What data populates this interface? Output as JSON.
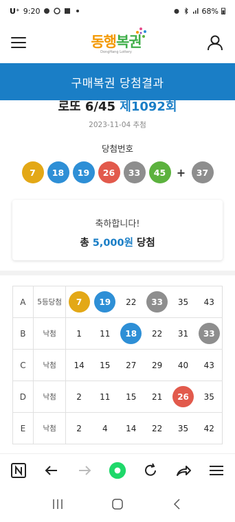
{
  "status": {
    "carrier": "U⁺",
    "time": "9:20",
    "battery": "68%"
  },
  "header": {
    "logo_main": "동행",
    "logo_main2": "복권",
    "logo_sub": "DongHang Lottery"
  },
  "title_bar": "구매복권 당첨결과",
  "draw": {
    "game": "로또 6/45",
    "round": "제1092회",
    "date": "2023-11-04 추첨"
  },
  "winning": {
    "label": "당첨번호",
    "numbers": [
      {
        "n": "7",
        "color": "#e3a817"
      },
      {
        "n": "18",
        "color": "#2e8fd6"
      },
      {
        "n": "19",
        "color": "#2e8fd6"
      },
      {
        "n": "26",
        "color": "#e25a4c"
      },
      {
        "n": "33",
        "color": "#8e8e8e"
      },
      {
        "n": "45",
        "color": "#5cb23e"
      }
    ],
    "plus": "+",
    "bonus": {
      "n": "37",
      "color": "#8e8e8e"
    }
  },
  "result": {
    "congrats": "축하합니다!",
    "prefix": "총 ",
    "amount": "5,000원",
    "suffix": " 당첨"
  },
  "ticket": [
    {
      "row": "A",
      "result": "5등당첨",
      "nums": [
        {
          "n": "7",
          "hit": true,
          "color": "#e3a817"
        },
        {
          "n": "19",
          "hit": true,
          "color": "#2e8fd6"
        },
        {
          "n": "22",
          "hit": false
        },
        {
          "n": "33",
          "hit": true,
          "color": "#8e8e8e"
        },
        {
          "n": "35",
          "hit": false
        },
        {
          "n": "43",
          "hit": false
        }
      ]
    },
    {
      "row": "B",
      "result": "낙첨",
      "nums": [
        {
          "n": "1",
          "hit": false
        },
        {
          "n": "11",
          "hit": false
        },
        {
          "n": "18",
          "hit": true,
          "color": "#2e8fd6"
        },
        {
          "n": "22",
          "hit": false
        },
        {
          "n": "31",
          "hit": false
        },
        {
          "n": "33",
          "hit": true,
          "color": "#8e8e8e"
        }
      ]
    },
    {
      "row": "C",
      "result": "낙첨",
      "nums": [
        {
          "n": "14",
          "hit": false
        },
        {
          "n": "15",
          "hit": false
        },
        {
          "n": "27",
          "hit": false
        },
        {
          "n": "29",
          "hit": false
        },
        {
          "n": "40",
          "hit": false
        },
        {
          "n": "43",
          "hit": false
        }
      ]
    },
    {
      "row": "D",
      "result": "낙첨",
      "nums": [
        {
          "n": "2",
          "hit": false
        },
        {
          "n": "11",
          "hit": false
        },
        {
          "n": "15",
          "hit": false
        },
        {
          "n": "21",
          "hit": false
        },
        {
          "n": "26",
          "hit": true,
          "color": "#e25a4c"
        },
        {
          "n": "35",
          "hit": false
        }
      ]
    },
    {
      "row": "E",
      "result": "낙첨",
      "nums": [
        {
          "n": "2",
          "hit": false
        },
        {
          "n": "4",
          "hit": false
        },
        {
          "n": "14",
          "hit": false
        },
        {
          "n": "22",
          "hit": false
        },
        {
          "n": "35",
          "hit": false
        },
        {
          "n": "42",
          "hit": false
        }
      ]
    }
  ],
  "browser_icons": [
    "naver-icon",
    "back-arrow-icon",
    "forward-arrow-icon",
    "home-dot-icon",
    "refresh-icon",
    "share-icon",
    "menu-icon"
  ],
  "nav_icons": [
    "recent-apps-icon",
    "home-icon",
    "back-icon"
  ]
}
